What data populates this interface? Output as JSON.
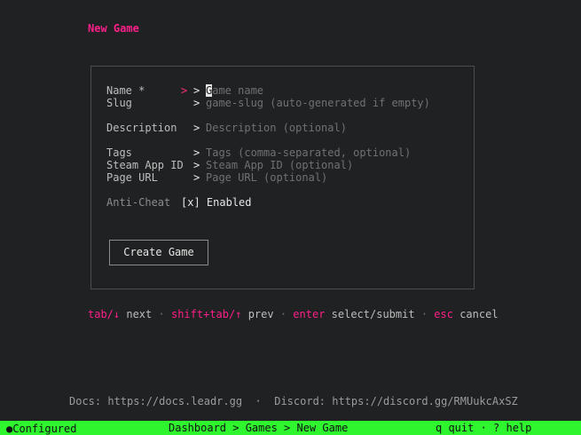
{
  "page": {
    "title": "New Game"
  },
  "form": {
    "name": {
      "label": "Name *",
      "prompt_marker": ">",
      "prompt": ">",
      "cursor_char": "G",
      "placeholder_rest": "ame name"
    },
    "slug": {
      "label": "Slug",
      "prompt": ">",
      "placeholder": "game-slug (auto-generated if empty)"
    },
    "description": {
      "label": "Description",
      "prompt": ">",
      "placeholder": "Description (optional)"
    },
    "tags": {
      "label": "Tags",
      "prompt": ">",
      "placeholder": "Tags (comma-separated, optional)"
    },
    "steam_app_id": {
      "label": "Steam App ID",
      "prompt": ">",
      "placeholder": "Steam App ID (optional)"
    },
    "page_url": {
      "label": "Page URL",
      "prompt": ">",
      "placeholder": "Page URL (optional)"
    },
    "anti_cheat": {
      "label": "Anti-Cheat",
      "checkbox": "[x]",
      "value": "Enabled"
    },
    "submit_label": "Create Game"
  },
  "help": {
    "items": [
      {
        "key": "tab/↓",
        "desc": "next"
      },
      {
        "key": "shift+tab/↑",
        "desc": "prev"
      },
      {
        "key": "enter",
        "desc": "select/submit"
      },
      {
        "key": "esc",
        "desc": "cancel"
      }
    ],
    "separator": "·"
  },
  "footer": {
    "docs_label": "Docs:",
    "docs_url": "https://docs.leadr.gg",
    "separator": "·",
    "discord_label": "Discord:",
    "discord_url": "https://discord.gg/RMUukcAxSZ"
  },
  "status_bar": {
    "indicator": "●",
    "state": "Configured",
    "breadcrumb": "Dashboard > Games > New Game",
    "shortcuts": "q quit · ? help"
  },
  "colors": {
    "accent": "#ff1f8a",
    "status_bg": "#2ef52e",
    "background": "#1f2122"
  }
}
